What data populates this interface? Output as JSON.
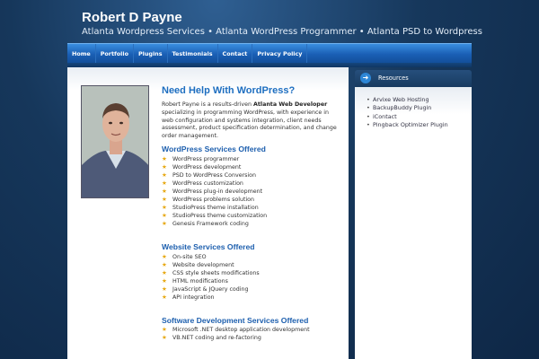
{
  "site": {
    "title": "Robert D Payne",
    "tagline": "Atlanta Wordpress Services • Atlanta WordPress Programmer • Atlanta PSD to Wordpress"
  },
  "nav": {
    "items": [
      "Home",
      "Portfolio",
      "Plugins",
      "Testimonials",
      "Contact",
      "Privacy Policy"
    ]
  },
  "main": {
    "heading": "Need Help With WordPress?",
    "intro_before": "Robert Payne is a results-driven ",
    "intro_bold": "Atlanta Web Developer",
    "intro_after": " specializing in programming WordPress, with experience in web configuration and systems integration, client needs assessment, product specification determination, and change order management.",
    "sections": [
      {
        "heading": "WordPress Services Offered",
        "items": [
          "WordPress programmer",
          "WordPress development",
          "PSD to WordPress Conversion",
          "WordPress customization",
          "WordPress plug-in development",
          "WordPress problems solution",
          "StudioPress theme installation",
          "StudioPress theme customization",
          "Genesis Framework coding"
        ]
      },
      {
        "heading": "Website Services Offered",
        "items": [
          "On-site SEO",
          "Website development",
          "CSS style sheets modifications",
          "HTML modifications",
          "JavaScript & JQuery coding",
          "API integration"
        ]
      },
      {
        "heading": "Software Development Services Offered",
        "items": [
          "Microsoft .NET desktop application development",
          "VB.NET coding and re-factoring"
        ]
      }
    ]
  },
  "sidebar": {
    "title": "Resources",
    "links": [
      "Arvixe Web Hosting",
      "BackupBuddy Plugin",
      "iContact",
      "Pingback Optimizer Plugin"
    ]
  },
  "colors": {
    "background": "#16375b",
    "nav": "#1a5fb5",
    "heading": "#1d6ec0",
    "bullet_star": "#e7a812"
  }
}
